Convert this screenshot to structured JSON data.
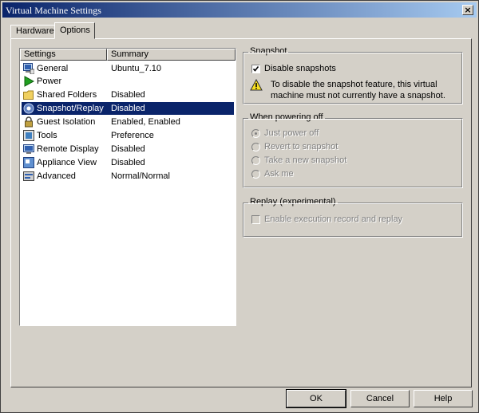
{
  "window": {
    "title": "Virtual Machine Settings",
    "close_label": "×"
  },
  "tabs": [
    {
      "label": "Hardware"
    },
    {
      "label": "Options"
    }
  ],
  "settings_list": {
    "headers": {
      "settings": "Settings",
      "summary": "Summary"
    },
    "rows": [
      {
        "name": "General",
        "summary": "Ubuntu_7.10",
        "icon": "general-icon"
      },
      {
        "name": "Power",
        "summary": "",
        "icon": "power-icon"
      },
      {
        "name": "Shared Folders",
        "summary": "Disabled",
        "icon": "folder-icon"
      },
      {
        "name": "Snapshot/Replay",
        "summary": "Disabled",
        "icon": "snapshot-icon"
      },
      {
        "name": "Guest Isolation",
        "summary": "Enabled, Enabled",
        "icon": "lock-icon"
      },
      {
        "name": "Tools",
        "summary": "Preference",
        "icon": "tools-icon"
      },
      {
        "name": "Remote Display",
        "summary": "Disabled",
        "icon": "remote-display-icon"
      },
      {
        "name": "Appliance View",
        "summary": "Disabled",
        "icon": "appliance-view-icon"
      },
      {
        "name": "Advanced",
        "summary": "Normal/Normal",
        "icon": "advanced-icon"
      }
    ],
    "selected_index": 3
  },
  "snapshot": {
    "group_title": "Snapshot",
    "disable_label": "Disable snapshots",
    "disable_checked": true,
    "warning_line1": "To disable the snapshot feature, this virtual",
    "warning_line2": "machine must not currently have a snapshot."
  },
  "powering_off": {
    "group_title": "When powering off",
    "options": [
      {
        "label": "Just power off",
        "selected": true
      },
      {
        "label": "Revert to snapshot",
        "selected": false
      },
      {
        "label": "Take a new snapshot",
        "selected": false
      },
      {
        "label": "Ask me",
        "selected": false
      }
    ]
  },
  "replay": {
    "group_title": "Replay (experimental)",
    "enable_label": "Enable execution record and replay"
  },
  "buttons": {
    "ok": "OK",
    "cancel": "Cancel",
    "help": "Help"
  }
}
